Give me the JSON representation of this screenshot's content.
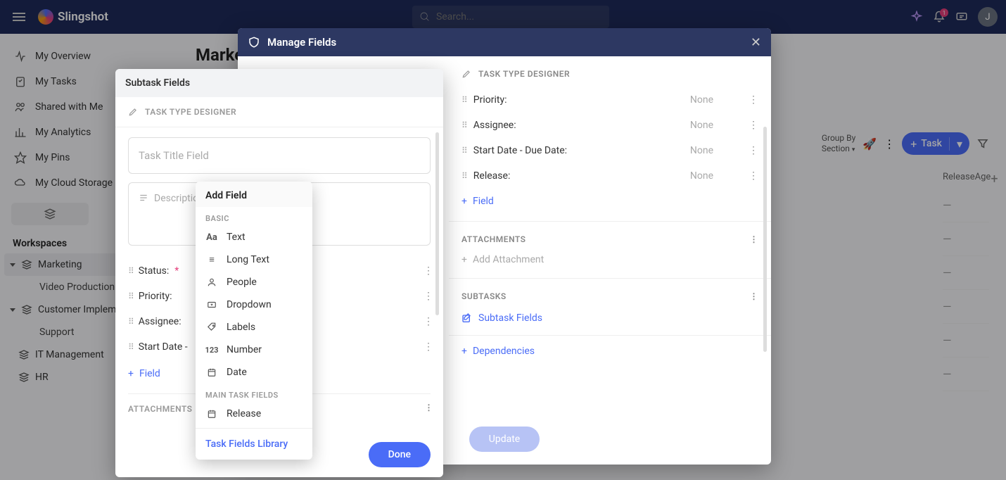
{
  "topbar": {
    "brand": "Slingshot",
    "search_placeholder": "Search...",
    "notification_count": "1",
    "avatar_initial": "J"
  },
  "sidebar": {
    "items": [
      {
        "label": "My Overview"
      },
      {
        "label": "My Tasks"
      },
      {
        "label": "Shared with Me"
      },
      {
        "label": "My Analytics"
      },
      {
        "label": "My Pins"
      },
      {
        "label": "My Cloud Storage"
      }
    ],
    "workspaces_label": "Workspaces",
    "workspaces": [
      {
        "label": "Marketing",
        "children": [
          "Video Production"
        ]
      },
      {
        "label": "Customer Implemen",
        "children": [
          "Support"
        ]
      },
      {
        "label": "IT Management",
        "children": []
      },
      {
        "label": "HR",
        "children": []
      }
    ]
  },
  "page": {
    "title": "Marke",
    "group_by_label": "Group By",
    "group_by_value": "Section",
    "task_button": "Task",
    "columns": [
      "Release",
      "Age"
    ]
  },
  "manage_modal": {
    "title": "Manage Fields",
    "designer_label": "TASK TYPE DESIGNER",
    "fields": [
      {
        "name": "Priority:",
        "value": "None"
      },
      {
        "name": "Assignee:",
        "value": "None"
      },
      {
        "name": "Start Date - Due Date:",
        "value": "None"
      },
      {
        "name": "Release:",
        "value": "None"
      }
    ],
    "add_field": "Field",
    "attachments_label": "ATTACHMENTS",
    "add_attachment": "Add Attachment",
    "subtasks_label": "SUBTASKS",
    "subtask_fields": "Subtask Fields",
    "dependencies": "Dependencies",
    "update_button": "Update"
  },
  "subtask_modal": {
    "title": "Subtask Fields",
    "designer_label": "TASK TYPE DESIGNER",
    "title_placeholder": "Task Title Field",
    "description_placeholder": "Descriptio",
    "fields": [
      {
        "name": "Status:",
        "required": true
      },
      {
        "name": "Priority:"
      },
      {
        "name": "Assignee:"
      },
      {
        "name": "Start Date -"
      }
    ],
    "add_field": "Field",
    "attachments_label": "ATTACHMENTS",
    "done_button": "Done"
  },
  "popover": {
    "title": "Add Field",
    "basic_label": "BASIC",
    "basic_items": [
      {
        "icon": "Aa",
        "label": "Text"
      },
      {
        "icon": "≡",
        "label": "Long Text"
      },
      {
        "icon": "person",
        "label": "People"
      },
      {
        "icon": "▾",
        "label": "Dropdown"
      },
      {
        "icon": "tag",
        "label": "Labels"
      },
      {
        "icon": "123",
        "label": "Number"
      },
      {
        "icon": "cal",
        "label": "Date"
      }
    ],
    "main_label": "MAIN TASK FIELDS",
    "main_items": [
      {
        "icon": "cal",
        "label": "Release"
      }
    ],
    "library_link": "Task Fields Library"
  },
  "colors": {
    "primary": "#4a6cf7",
    "topbar": "#1e2a5a",
    "accent": "#e53e7b"
  }
}
